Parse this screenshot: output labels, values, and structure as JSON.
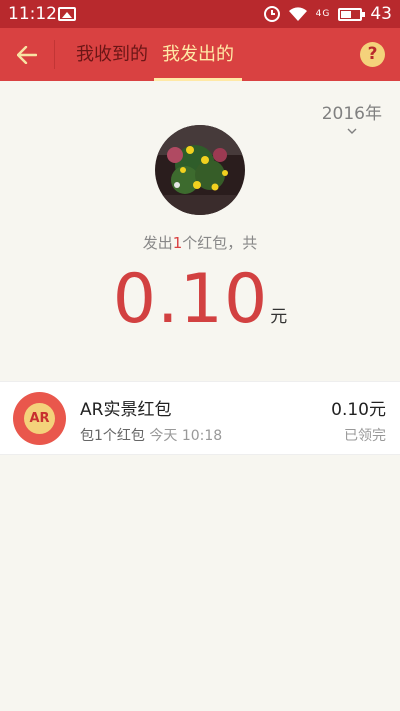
{
  "status_bar": {
    "time": "11:12",
    "signal": "4G",
    "battery": "43"
  },
  "header": {
    "tabs": [
      {
        "label": "我收到的",
        "active": false
      },
      {
        "label": "我发出的",
        "active": true
      }
    ],
    "help_label": "?"
  },
  "year_selector": {
    "label": "2016年"
  },
  "summary": {
    "prefix": "发出",
    "count": "1",
    "suffix": "个红包，共"
  },
  "total": {
    "amount": "0.10",
    "unit": "元"
  },
  "records": [
    {
      "icon_text": "AR",
      "title": "AR实景红包",
      "sub_prefix": "包",
      "sub_count": "1个红包",
      "time": "今天 10:18",
      "amount": "0.10元",
      "status": "已领完"
    }
  ],
  "colors": {
    "header": "#d94141",
    "status_bar": "#b8292d",
    "accent_gold": "#ffe9a6",
    "amount_red": "#d24141",
    "background": "#f7f6f0"
  }
}
